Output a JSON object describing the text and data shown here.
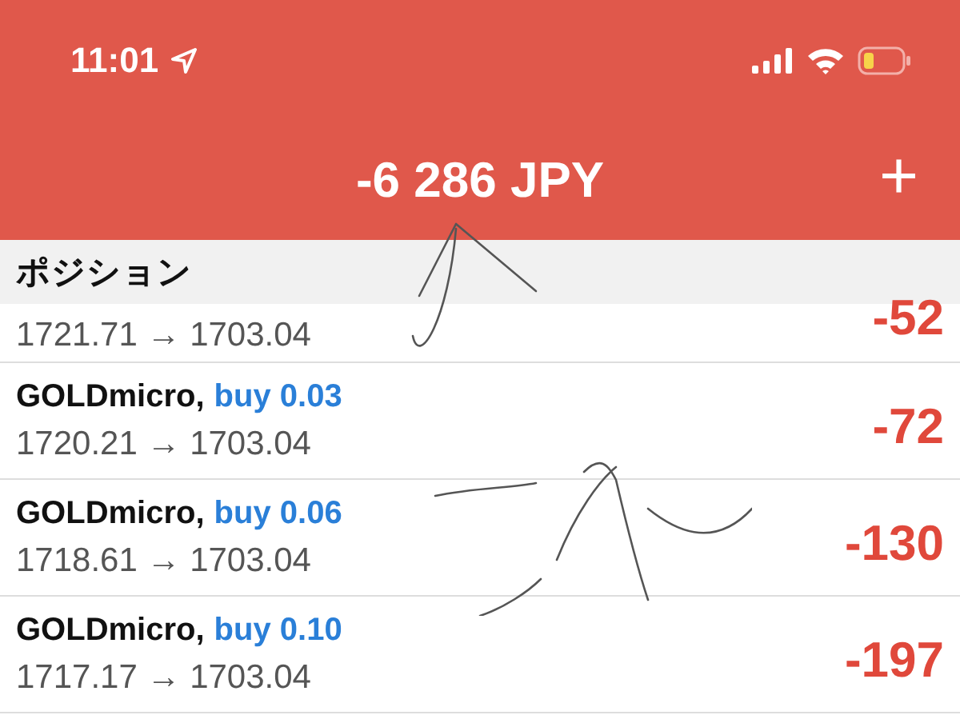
{
  "status_bar": {
    "time": "11:01"
  },
  "header": {
    "title": "-6 286 JPY",
    "add_button": "+"
  },
  "section_title": "ポジション",
  "positions": [
    {
      "prices": "1721.71 → 1703.04",
      "profit": "-52"
    },
    {
      "symbol": "GOLDmicro,",
      "order": "buy 0.03",
      "prices": "1720.21 → 1703.04",
      "profit": "-72"
    },
    {
      "symbol": "GOLDmicro,",
      "order": "buy 0.06",
      "prices": "1718.61 → 1703.04",
      "profit": "-130"
    },
    {
      "symbol": "GOLDmicro,",
      "order": "buy 0.10",
      "prices": "1717.17 → 1703.04",
      "profit": "-197"
    }
  ]
}
